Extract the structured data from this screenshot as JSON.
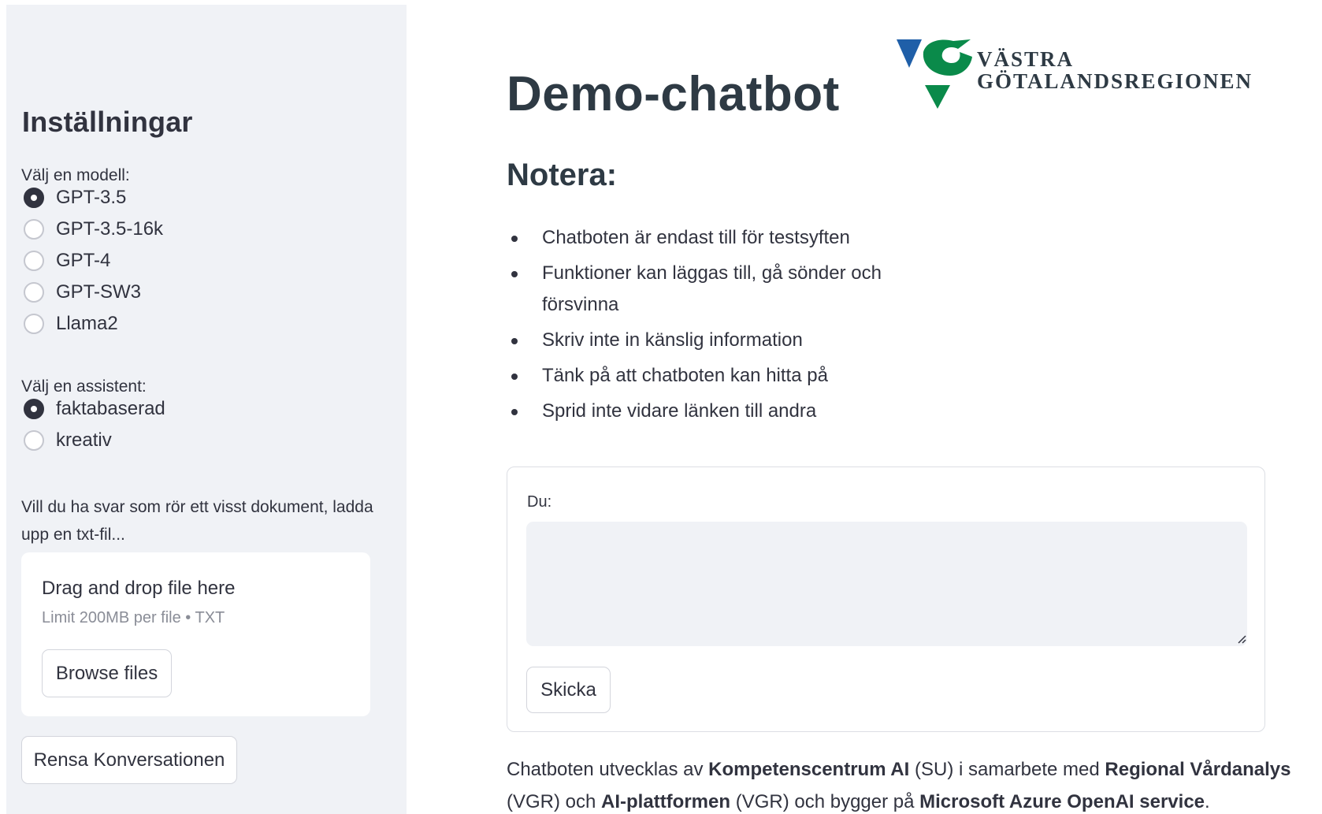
{
  "sidebar": {
    "title": "Inställningar",
    "model_label": "Välj en modell:",
    "models": [
      {
        "label": "GPT-3.5",
        "checked": true
      },
      {
        "label": "GPT-3.5-16k",
        "checked": false
      },
      {
        "label": "GPT-4",
        "checked": false
      },
      {
        "label": "GPT-SW3",
        "checked": false
      },
      {
        "label": "Llama2",
        "checked": false
      }
    ],
    "assistant_label": "Välj en assistent:",
    "assistants": [
      {
        "label": "faktabaserad",
        "checked": true
      },
      {
        "label": "kreativ",
        "checked": false
      }
    ],
    "upload_note": "Vill du ha svar som rör ett visst dokument, ladda upp en txt-fil...",
    "uploader": {
      "title": "Drag and drop file here",
      "limit": "Limit 200MB per file • TXT",
      "browse_label": "Browse files"
    },
    "clear_label": "Rensa Konversationen"
  },
  "main": {
    "title": "Demo-chatbot",
    "logo": {
      "line1": "VÄSTRA",
      "line2": "GÖTALANDSREGIONEN"
    },
    "notes_heading": "Notera:",
    "notes": [
      "Chatboten är endast till för testsyften",
      "Funktioner kan läggas till, gå sönder och försvinna",
      "Skriv inte in känslig information",
      "Tänk på att chatboten kan hitta på",
      "Sprid inte vidare länken till andra"
    ],
    "form": {
      "input_label": "Du:",
      "input_value": "",
      "send_label": "Skicka"
    },
    "footer": {
      "t1": "Chatboten utvecklas av ",
      "b1": "Kompetenscentrum AI",
      "t2": " (SU) i samarbete med ",
      "b2": "Regional Vårdanalys",
      "t3": " (VGR) och ",
      "b3": "AI-plattformen",
      "t4": " (VGR) och bygger på ",
      "b4": "Microsoft Azure OpenAI service",
      "t5": "."
    }
  },
  "colors": {
    "sidebar_bg": "#f0f2f6",
    "text": "#31333f",
    "logo_blue": "#1f5fa8",
    "logo_green": "#0a8a4a"
  }
}
